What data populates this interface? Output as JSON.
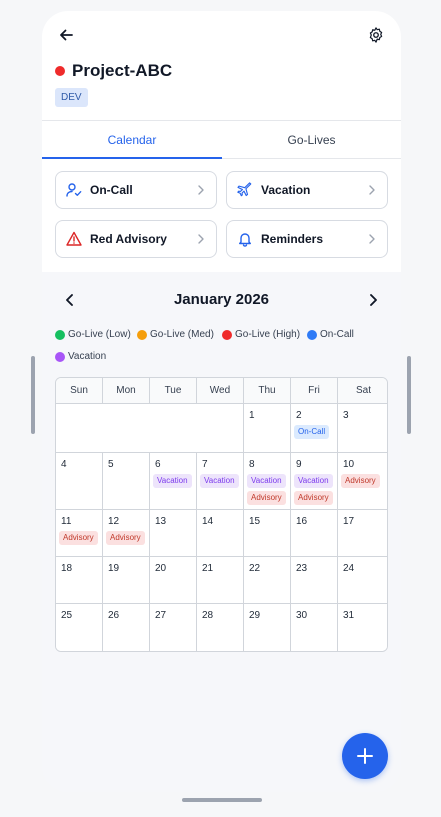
{
  "header": {
    "title": "Project-ABC",
    "env_badge": "DEV",
    "status_color": "#ef2b2b"
  },
  "tabs": [
    {
      "label": "Calendar",
      "active": true
    },
    {
      "label": "Go-Lives",
      "active": false
    }
  ],
  "quick_actions": [
    {
      "label": "On-Call",
      "icon": "user-check-icon"
    },
    {
      "label": "Vacation",
      "icon": "plane-icon"
    },
    {
      "label": "Red Advisory",
      "icon": "warning-icon"
    },
    {
      "label": "Reminders",
      "icon": "bell-icon"
    }
  ],
  "calendar": {
    "month_label": "January 2026",
    "weekdays": [
      "Sun",
      "Mon",
      "Tue",
      "Wed",
      "Thu",
      "Fri",
      "Sat"
    ],
    "legend": [
      {
        "label": "Go-Live (Low)",
        "color": "#16c060"
      },
      {
        "label": "Go-Live (Med)",
        "color": "#f59e0b"
      },
      {
        "label": "Go-Live (High)",
        "color": "#ef2b2b"
      },
      {
        "label": "On-Call",
        "color": "#2f7bf6"
      },
      {
        "label": "Vacation",
        "color": "#a855f7"
      }
    ],
    "weeks": [
      [
        null,
        null,
        null,
        null,
        {
          "day": "1"
        },
        {
          "day": "2",
          "events": [
            "On-Call"
          ]
        },
        {
          "day": "3"
        }
      ],
      [
        {
          "day": "4"
        },
        {
          "day": "5"
        },
        {
          "day": "6",
          "events": [
            "Vacation"
          ]
        },
        {
          "day": "7",
          "events": [
            "Vacation"
          ]
        },
        {
          "day": "8",
          "events": [
            "Vacation",
            "Advisory"
          ]
        },
        {
          "day": "9",
          "events": [
            "Vacation",
            "Advisory"
          ]
        },
        {
          "day": "10",
          "events": [
            "Advisory"
          ]
        }
      ],
      [
        {
          "day": "11",
          "events": [
            "Advisory"
          ]
        },
        {
          "day": "12",
          "events": [
            "Advisory"
          ]
        },
        {
          "day": "13"
        },
        {
          "day": "14"
        },
        {
          "day": "15"
        },
        {
          "day": "16"
        },
        {
          "day": "17"
        }
      ],
      [
        {
          "day": "18"
        },
        {
          "day": "19"
        },
        {
          "day": "20"
        },
        {
          "day": "21"
        },
        {
          "day": "22"
        },
        {
          "day": "23"
        },
        {
          "day": "24"
        }
      ],
      [
        {
          "day": "25"
        },
        {
          "day": "26"
        },
        {
          "day": "27"
        },
        {
          "day": "28"
        },
        {
          "day": "29"
        },
        {
          "day": "30"
        },
        {
          "day": "31"
        }
      ]
    ]
  },
  "fab": {
    "icon": "plus-icon"
  }
}
